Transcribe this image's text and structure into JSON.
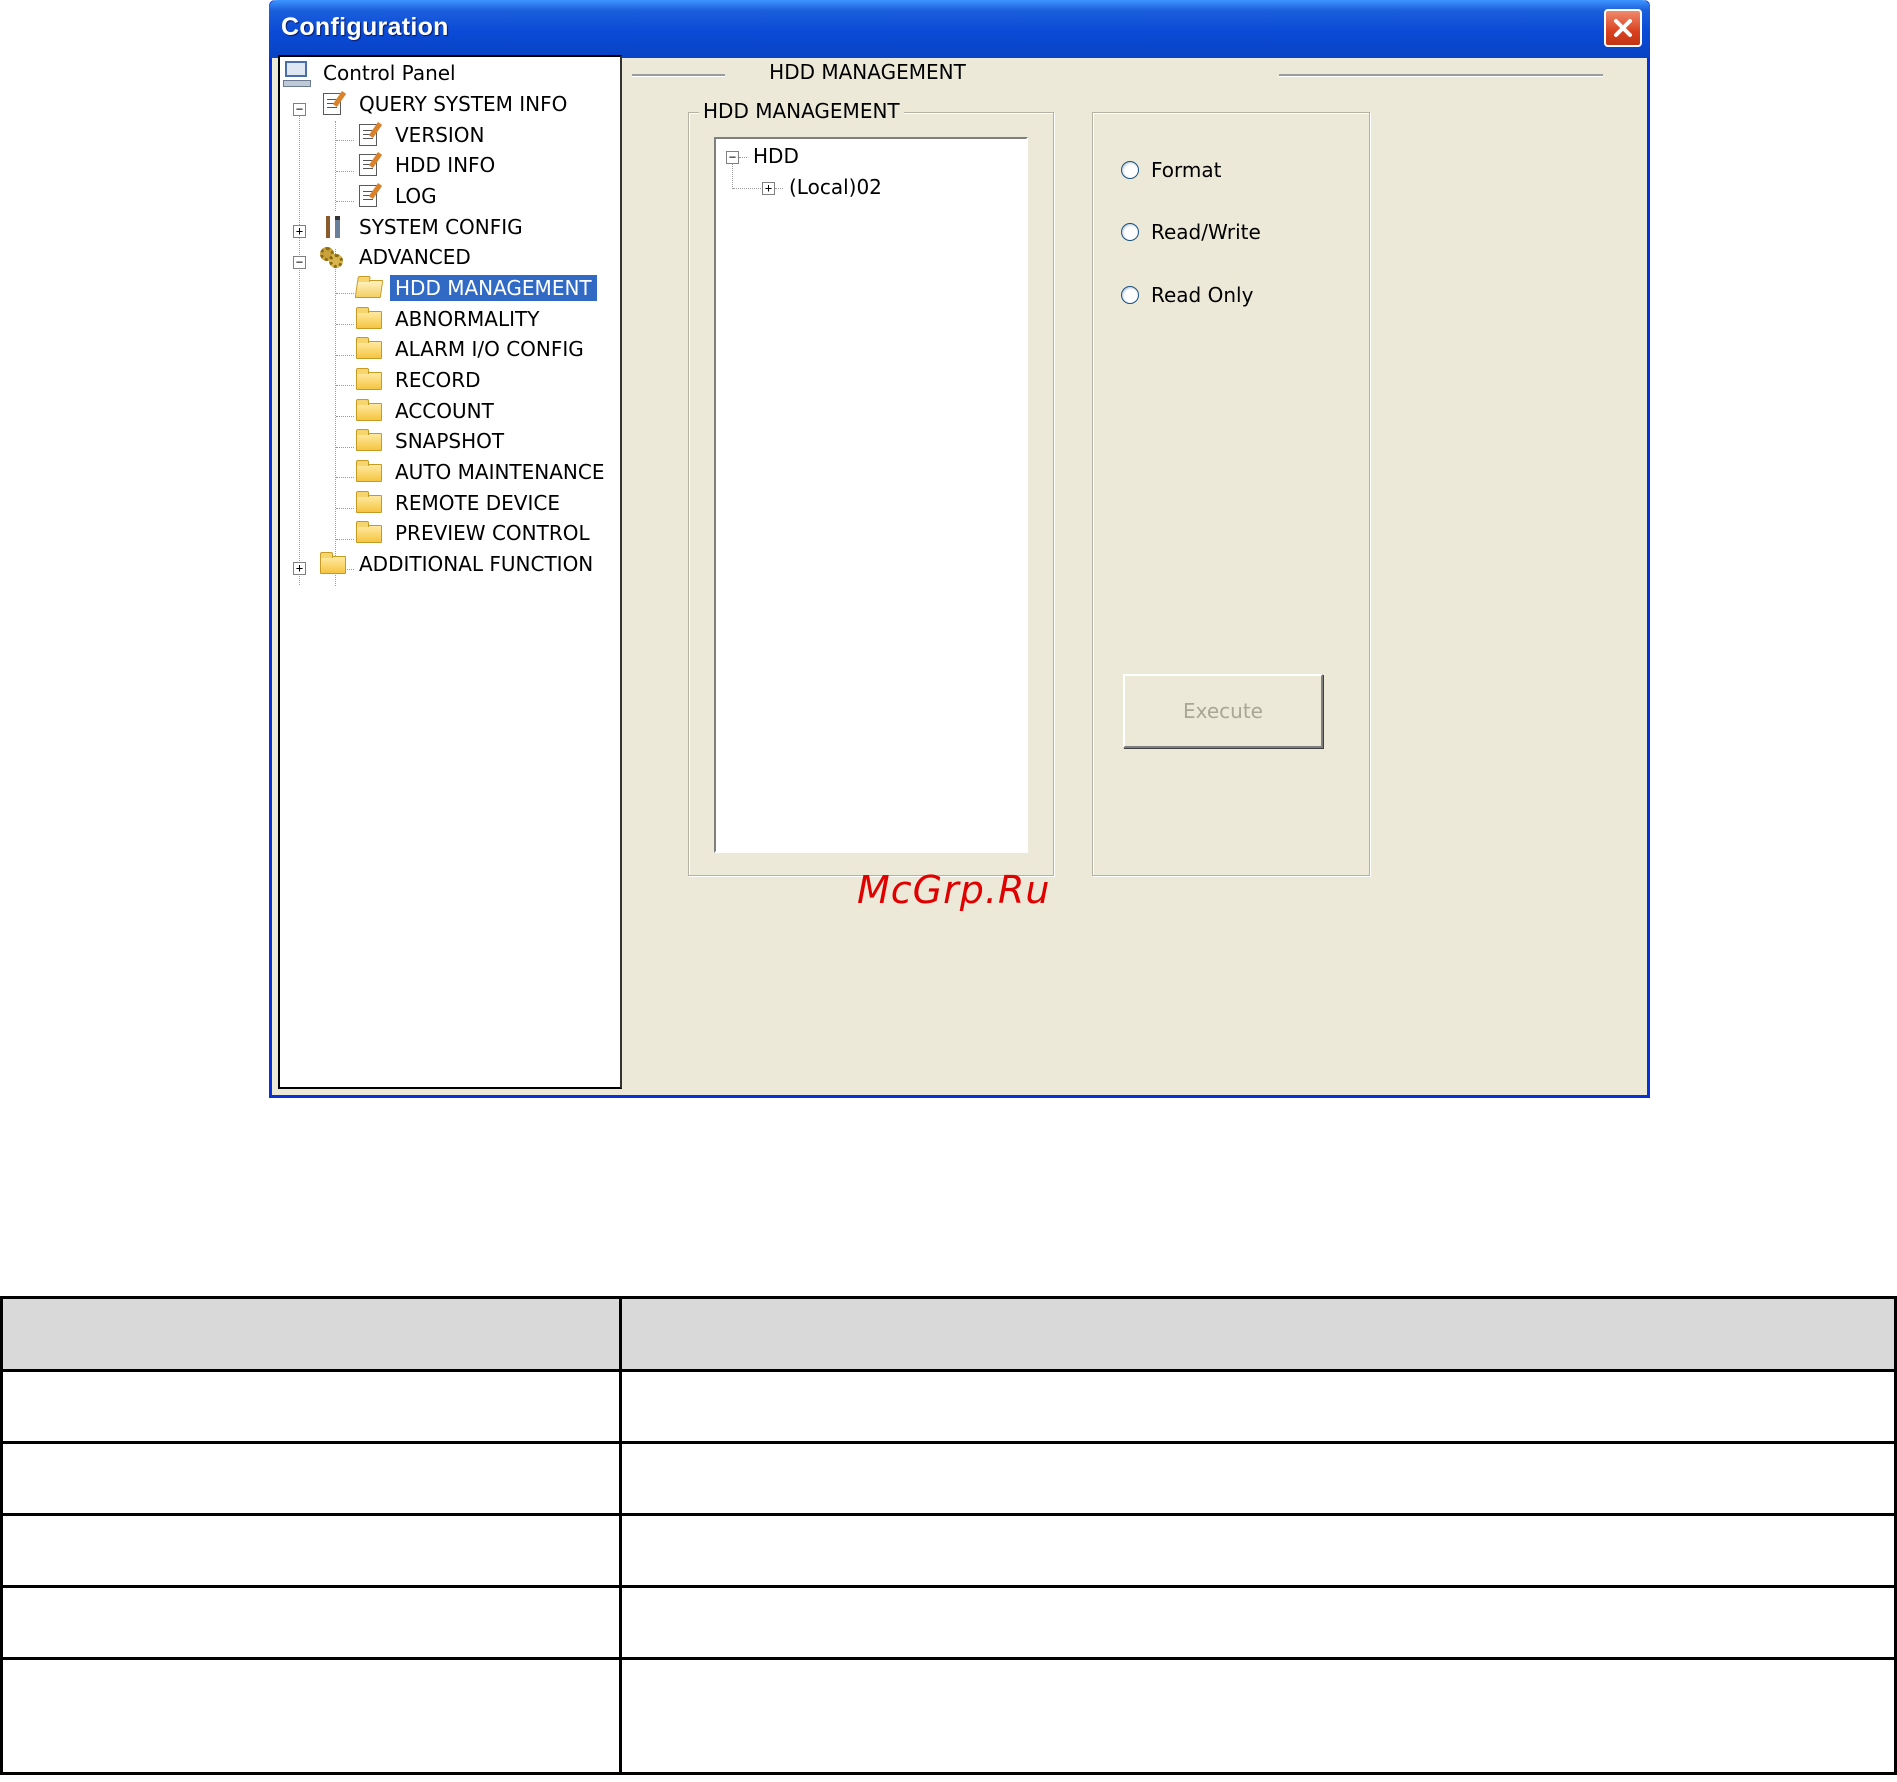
{
  "window": {
    "title": "Configuration",
    "close_label": "✕"
  },
  "tree": {
    "items": [
      {
        "label": "Control Panel",
        "icon": "computer-icon"
      },
      {
        "label": "QUERY SYSTEM INFO",
        "icon": "note-icon",
        "expander": "−"
      },
      {
        "label": "VERSION",
        "icon": "note-icon"
      },
      {
        "label": "HDD INFO",
        "icon": "note-icon"
      },
      {
        "label": "LOG",
        "icon": "note-icon"
      },
      {
        "label": "SYSTEM CONFIG",
        "icon": "tools-icon",
        "expander": "+"
      },
      {
        "label": "ADVANCED",
        "icon": "gears-icon",
        "expander": "−"
      },
      {
        "label": "HDD MANAGEMENT",
        "icon": "folder-open-icon",
        "selected": true
      },
      {
        "label": "ABNORMALITY",
        "icon": "folder-icon"
      },
      {
        "label": "ALARM I/O CONFIG",
        "icon": "folder-icon"
      },
      {
        "label": "RECORD",
        "icon": "folder-icon"
      },
      {
        "label": "ACCOUNT",
        "icon": "folder-icon"
      },
      {
        "label": "SNAPSHOT",
        "icon": "folder-icon"
      },
      {
        "label": "AUTO MAINTENANCE",
        "icon": "folder-icon"
      },
      {
        "label": "REMOTE DEVICE",
        "icon": "folder-icon"
      },
      {
        "label": "PREVIEW CONTROL",
        "icon": "folder-icon"
      },
      {
        "label": "ADDITIONAL FUNCTION",
        "icon": "folder-icon",
        "expander": "+"
      }
    ]
  },
  "main": {
    "header": "HDD MANAGEMENT",
    "group_title": "HDD MANAGEMENT",
    "hdd_tree": {
      "root": "HDD",
      "root_expander": "−",
      "child": "(Local)02",
      "child_expander": "+"
    },
    "options": [
      "Format",
      "Read/Write",
      "Read Only"
    ],
    "execute_label": "Execute"
  },
  "watermark": "McGrp.Ru",
  "table": {
    "rows": 6
  }
}
